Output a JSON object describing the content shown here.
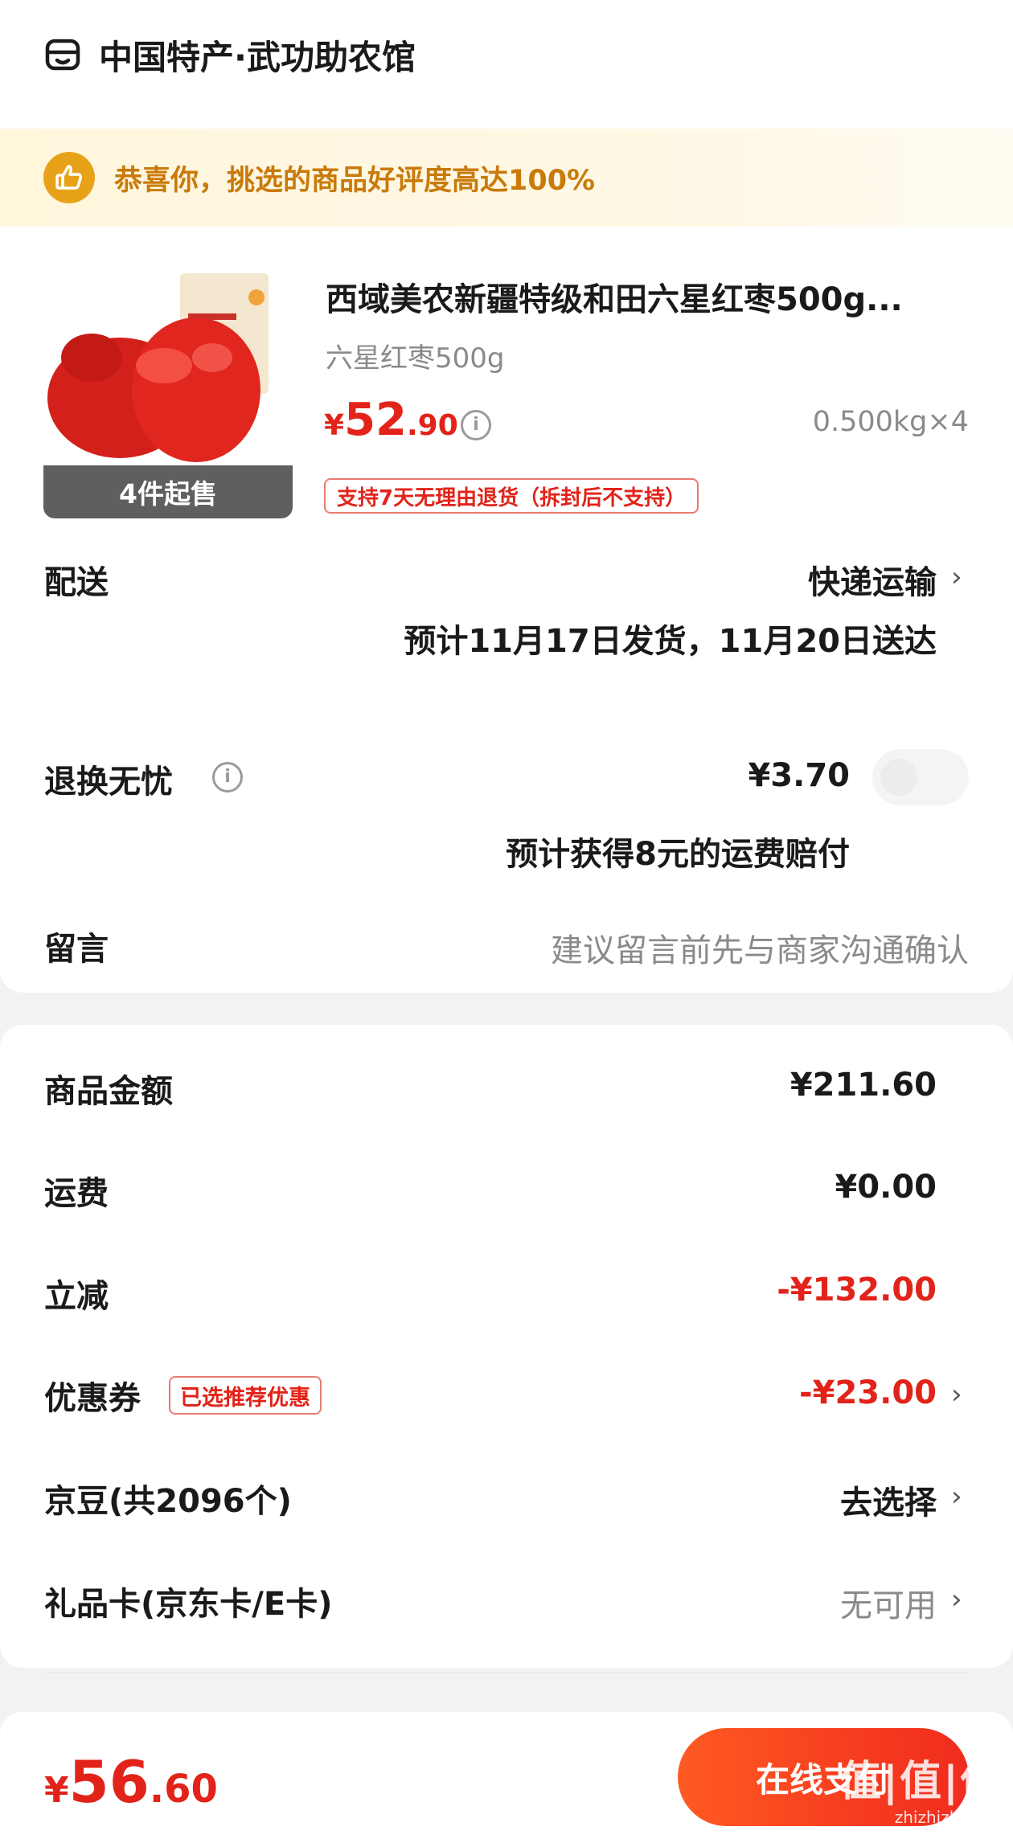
{
  "shop": {
    "name": "中国特产·武功助农馆",
    "icon": "store-icon"
  },
  "banner": {
    "text": "恭喜你，挑选的商品好评度高达100%",
    "icon": "thumbs-up-icon"
  },
  "product": {
    "title": "西域美农新疆特级和田六星红枣500g...",
    "spec": "六星红枣500g",
    "price_currency": "¥",
    "price_int": "52",
    "price_dec": ".90",
    "info_icon_text": "i",
    "quantity": "0.500kg×4",
    "min_order": "4件起售",
    "return_policy": "支持7天无理由退货（拆封后不支持）"
  },
  "delivery": {
    "label": "配送",
    "method": "快递运输",
    "estimate": "预计11月17日发货，11月20日送达"
  },
  "return_ins": {
    "label": "退换无忧",
    "price": "¥3.70",
    "note": "预计获得8元的运费赔付",
    "enabled": false
  },
  "message": {
    "label": "留言",
    "placeholder": "建议留言前先与商家沟通确认"
  },
  "summary": {
    "goods_label": "商品金额",
    "goods_value": "¥211.60",
    "shipping_label": "运费",
    "shipping_value": "¥0.00",
    "discount_label": "立减",
    "discount_value": "-¥132.00",
    "coupon_label": "优惠券",
    "coupon_tag": "已选推荐优惠",
    "coupon_value": "-¥23.00",
    "jingdou_label": "京豆(共2096个)",
    "jingdou_value": "去选择",
    "giftcard_label": "礼品卡(京东卡/E卡)",
    "giftcard_value": "无可用"
  },
  "footer": {
    "total_currency": "¥",
    "total_int": "56",
    "total_dec": ".60",
    "pay_label": "在线支付",
    "watermark_big": "值|值|值",
    "watermark_small": "zhizhizhi.com"
  },
  "colors": {
    "accent": "#e2231a",
    "banner_text": "#c97a0a",
    "pay_start": "#ff5a22",
    "pay_end": "#f02b1e"
  }
}
